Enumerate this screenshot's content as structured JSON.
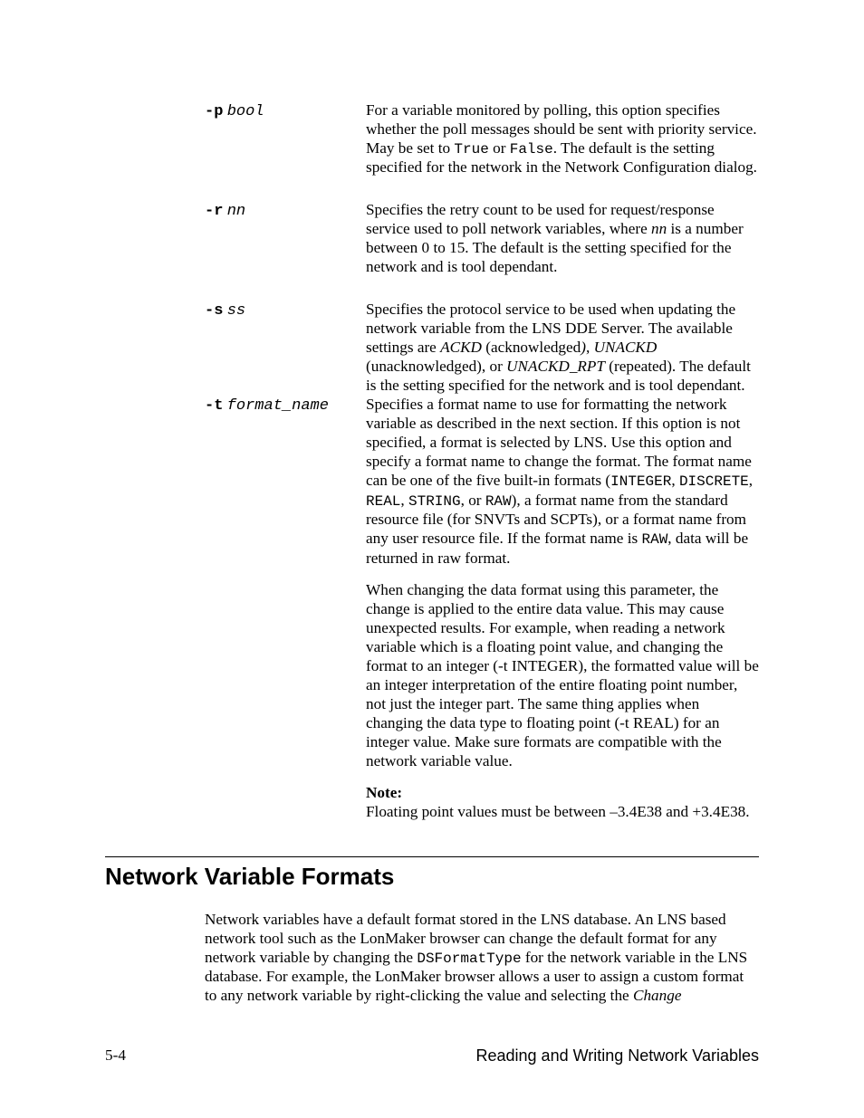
{
  "options": {
    "p": {
      "flag": "-p",
      "arg": "bool",
      "desc_pre": "For a variable monitored by polling, this option specifies whether the poll messages should be sent with priority service.  May be set to ",
      "true": "True",
      "or": " or ",
      "false": "False",
      "desc_post": ". The default is the setting specified for the network in the Network Configuration dialog."
    },
    "r": {
      "flag": "-r",
      "arg": "nn",
      "desc_pre": "Specifies the retry count to be used for request/response service used to poll network variables, where ",
      "nn": "nn",
      "desc_post": " is a number between 0 to 15. The default is the setting specified for the network and is tool dependant."
    },
    "s": {
      "flag": "-s",
      "arg": "ss",
      "desc_pre": "Specifies the protocol service to be used when updating the network variable from the LNS DDE Server.  The available settings are ",
      "ackd": "ACKD",
      "p1": " (acknowledged",
      "paren_it": ")",
      "p2": ", ",
      "unackd": "UNACKD",
      "p3": " (unacknowledged), or ",
      "unackd_rpt": "UNACKD_RPT",
      "desc_post": " (repeated). The default is the setting specified for the network and is tool dependant."
    },
    "t": {
      "flag": "-t",
      "arg": "format_name",
      "d1a": "Specifies a format name to use for formatting the network variable as described in the next section. If this option is not specified, a format is selected by LNS.  Use this option and specify a format name to change the format.  The format name can be one of the five built-in formats (",
      "integer": "INTEGER",
      "comma1": ", ",
      "discrete": "DISCRETE",
      "comma2": ", ",
      "real": "REAL",
      "comma3": ", ",
      "string": "STRING",
      "or": ", or ",
      "raw": "RAW",
      "d1b": "), a format name from the standard resource file (for SNVTs and SCPTs), or a format name from any user resource file.  If the format name is ",
      "raw2": "RAW",
      "d1c": ", data will be returned in raw format.",
      "d2": "When changing the data format using this parameter, the change is applied to the entire data value.  This may cause unexpected results.  For example, when reading a network variable which is a floating point value, and changing the format to an integer (-t INTEGER), the formatted value will be an integer interpretation of the entire floating point number, not just the integer part.  The same thing applies when changing the data type to floating point (-t REAL) for an integer value. Make sure formats are compatible with the network variable value.",
      "note_label": "Note:",
      "note": "Floating point values must be between –3.4E38 and +3.4E38."
    }
  },
  "section": {
    "heading": "Network Variable Formats",
    "para_pre": "Network variables have a default format stored in the LNS database.  An LNS based network tool such as the LonMaker browser can change the default format for any network variable by changing the ",
    "code": "DSFormatType",
    "para_mid": " for the network variable in the LNS database.  For example, the LonMaker browser allows a user to assign a custom format to any network variable by right-clicking the value and selecting the ",
    "change": "Change"
  },
  "footer": {
    "left": "5-4",
    "right": "Reading and Writing Network Variables"
  }
}
